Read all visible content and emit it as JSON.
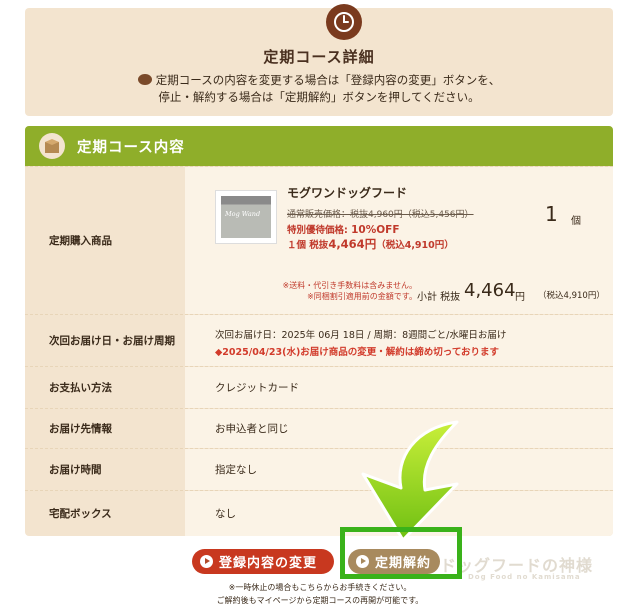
{
  "detail": {
    "title": "定期コース詳細",
    "desc_line1": "定期コースの内容を変更する場合は「登録内容の変更」ボタンを、",
    "desc_line2": "停止・解約する場合は「定期解約」ボタンを押してください。"
  },
  "course": {
    "header_title": "定期コース内容",
    "rows": {
      "product_label": "定期購入商品",
      "next_label": "次回お届け日・お届け周期",
      "payment_label": "お支払い方法",
      "payment_value": "クレジットカード",
      "address_label": "お届け先情報",
      "address_value": "お申込者と同じ",
      "time_label": "お届け時間",
      "time_value": "指定なし",
      "box_label": "宅配ボックス",
      "box_value": "なし"
    },
    "product": {
      "image_text": "Mog Wand",
      "name": "モグワンドッグフード",
      "regular_price": "通常販売価格：税抜4,960円（税込5,456円）",
      "special_label": "特別優待価格: ",
      "special_pct": "10%OFF",
      "unit_prefix": "１個 税抜",
      "unit_price": "4,464円",
      "unit_tax": "（税込4,910円）",
      "qty": "1",
      "qty_unit": "個"
    },
    "notes_line1": "※送料・代引き手数料は含みません。",
    "notes_line2": "※同梱割引適用前の金額です。",
    "subtotal": {
      "label": "小計 税抜",
      "amount": "4,464",
      "yen": "円",
      "tax": "（税込4,910円）"
    },
    "next_delivery": "次回お届け日：2025年 06月 18日 / 周期：8週間ごと/水曜日お届け",
    "deadline": "◆2025/04/23(水)お届け商品の変更・解約は締め切っております"
  },
  "buttons": {
    "change": "登録内容の変更",
    "cancel": "定期解約"
  },
  "footer": {
    "line1": "※一時休止の場合もこちらからお手続きください。",
    "line2": "ご解約後もマイページから定期コースの再開が可能です。"
  },
  "watermark": {
    "text": "ドッグフードの神様",
    "sub": "Dog Food no Kamisama"
  },
  "colors": {
    "panel_bg": "#f3e4cf",
    "header_green": "#8fae2a",
    "change_button": "#c8381f",
    "cancel_button": "#a88a5e",
    "highlight_green": "#3ab21a",
    "arrow_green": "#8fd01a"
  }
}
